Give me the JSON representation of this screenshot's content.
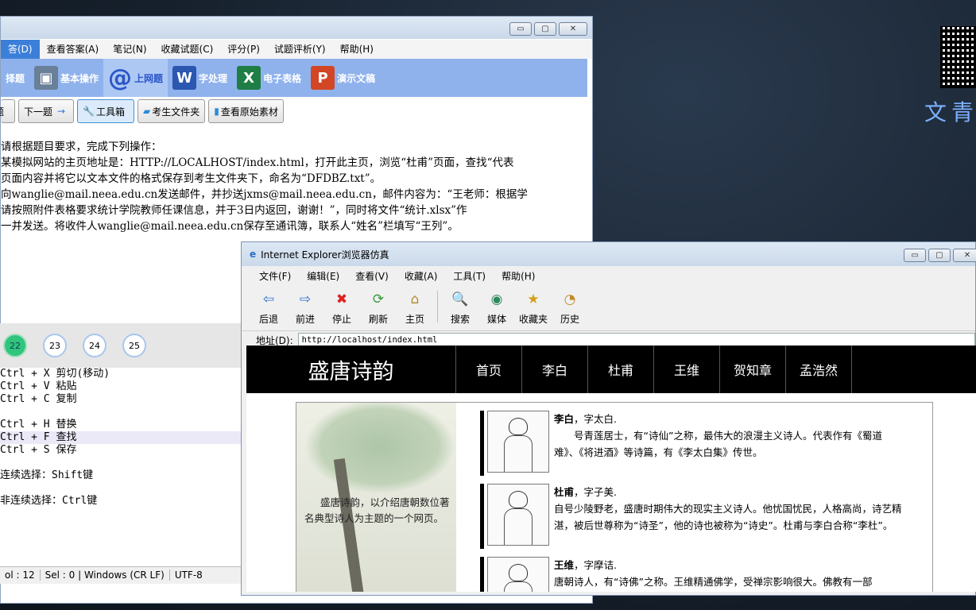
{
  "desktop": {
    "brand_text": "文青启"
  },
  "exam": {
    "window_controls": [
      "▭",
      "▢",
      "✕"
    ],
    "menu": [
      "答(D)",
      "查看答案(A)",
      "笔记(N)",
      "收藏试题(C)",
      "评分(P)",
      "试题评析(Y)",
      "帮助(H)"
    ],
    "modules": [
      {
        "label": "择题",
        "icon": "choice-icon",
        "color": "#4a78d0"
      },
      {
        "label": "基本操作",
        "icon": "basic-ops-icon",
        "color": "#6a7f98"
      },
      {
        "label": "上网题",
        "icon": "at-icon",
        "color": "#2a56c6"
      },
      {
        "label": "字处理",
        "icon": "word-icon",
        "color": "#2b57b0"
      },
      {
        "label": "电子表格",
        "icon": "excel-icon",
        "color": "#1e7e45"
      },
      {
        "label": "演示文稿",
        "icon": "ppt-icon",
        "color": "#d24625"
      }
    ],
    "nav_buttons": {
      "prev": "题",
      "next": "下一题",
      "toolbox": "工具箱",
      "student_folder": "考生文件夹",
      "raw_material": "查看原始素材"
    },
    "question_lines": [
      "  请根据题目要求，完成下列操作：",
      "某模拟网站的主页地址是：HTTP://LOCALHOST/index.html，打开此主页，浏览“杜甫”页面，查找“代表",
      "页面内容并将它以文本文件的格式保存到考生文件夹下，命名为“DFDBZ.txt”。",
      "向wanglie@mail.neea.edu.cn发送邮件，并抄送jxms@mail.neea.edu.cn，邮件内容为：“王老师：根据学",
      "  请按照附件表格要求统计学院教师任课信息，并于3日内返回，谢谢！”，同时将文件“统计.xlsx”作",
      "一并发送。将收件人wanglie@mail.neea.edu.cn保存至通讯簿，联系人“姓名”栏填写“王列”。"
    ],
    "question_numbers": [
      {
        "n": "22",
        "done": true
      },
      {
        "n": "23",
        "done": false
      },
      {
        "n": "24",
        "done": false
      },
      {
        "n": "25",
        "done": false
      }
    ],
    "editor_lines": [
      {
        "t": "Ctrl + X 剪切(移动)",
        "hl": false
      },
      {
        "t": "Ctrl + V 粘贴",
        "hl": false
      },
      {
        "t": "Ctrl + C 复制",
        "hl": false
      },
      {
        "t": "",
        "hl": false
      },
      {
        "t": "Ctrl + H 替换",
        "hl": false
      },
      {
        "t": "Ctrl + F 查找",
        "hl": true
      },
      {
        "t": "Ctrl + S 保存",
        "hl": false
      },
      {
        "t": "",
        "hl": false
      },
      {
        "t": "连续选择：Shift键",
        "hl": false
      },
      {
        "t": "",
        "hl": false
      },
      {
        "t": "非连续选择：Ctrl键",
        "hl": false
      }
    ],
    "status": [
      "ol : 12",
      "Sel : 0 | Windows (CR LF)",
      "UTF-8"
    ]
  },
  "ie": {
    "title": "Internet Explorer浏览器仿真",
    "menu": [
      "文件(F)",
      "编辑(E)",
      "查看(V)",
      "收藏(A)",
      "工具(T)",
      "帮助(H)"
    ],
    "tools": [
      {
        "label": "后退",
        "icon": "back-arrow-icon",
        "glyph": "⇦"
      },
      {
        "label": "前进",
        "icon": "forward-arrow-icon",
        "glyph": "⇨"
      },
      {
        "label": "停止",
        "icon": "stop-icon",
        "glyph": "✖"
      },
      {
        "label": "刷新",
        "icon": "refresh-icon",
        "glyph": "⟳"
      },
      {
        "label": "主页",
        "icon": "home-icon",
        "glyph": "⌂"
      },
      {
        "label": "搜索",
        "icon": "search-icon",
        "glyph": "🔍"
      },
      {
        "label": "媒体",
        "icon": "media-icon",
        "glyph": "◉"
      },
      {
        "label": "收藏夹",
        "icon": "favorites-icon",
        "glyph": "★"
      },
      {
        "label": "历史",
        "icon": "history-icon",
        "glyph": "◔"
      }
    ],
    "address_label": "地址(D):",
    "address": "http://localhost/index.html",
    "site": {
      "logo": "盛唐诗韵",
      "tabs": [
        "首页",
        "李白",
        "杜甫",
        "王维",
        "贺知章",
        "孟浩然"
      ],
      "intro": "盛唐诗韵，以介绍唐朝数位著名典型诗人为主题的一个网页。",
      "poets": [
        {
          "name": "李白",
          "rest": "，字太白.",
          "bio": "　　号青莲居士，有“诗仙”之称，最伟大的浪漫主义诗人。代表作有《蜀道难》、《将进酒》等诗篇，有《李太白集》传世。"
        },
        {
          "name": "杜甫",
          "rest": "，字子美.",
          "bio": "自号少陵野老，盛唐时期伟大的现实主义诗人。他忧国忧民，人格高尚，诗艺精湛，被后世尊称为“诗圣”，他的诗也被称为“诗史”。杜甫与李白合称“李杜”。"
        },
        {
          "name": "王维",
          "rest": "，字摩诘.",
          "bio": "唐朝诗人，有“诗佛”之称。王维精通佛学，受禅宗影响很大。佛教有一部"
        }
      ]
    }
  }
}
